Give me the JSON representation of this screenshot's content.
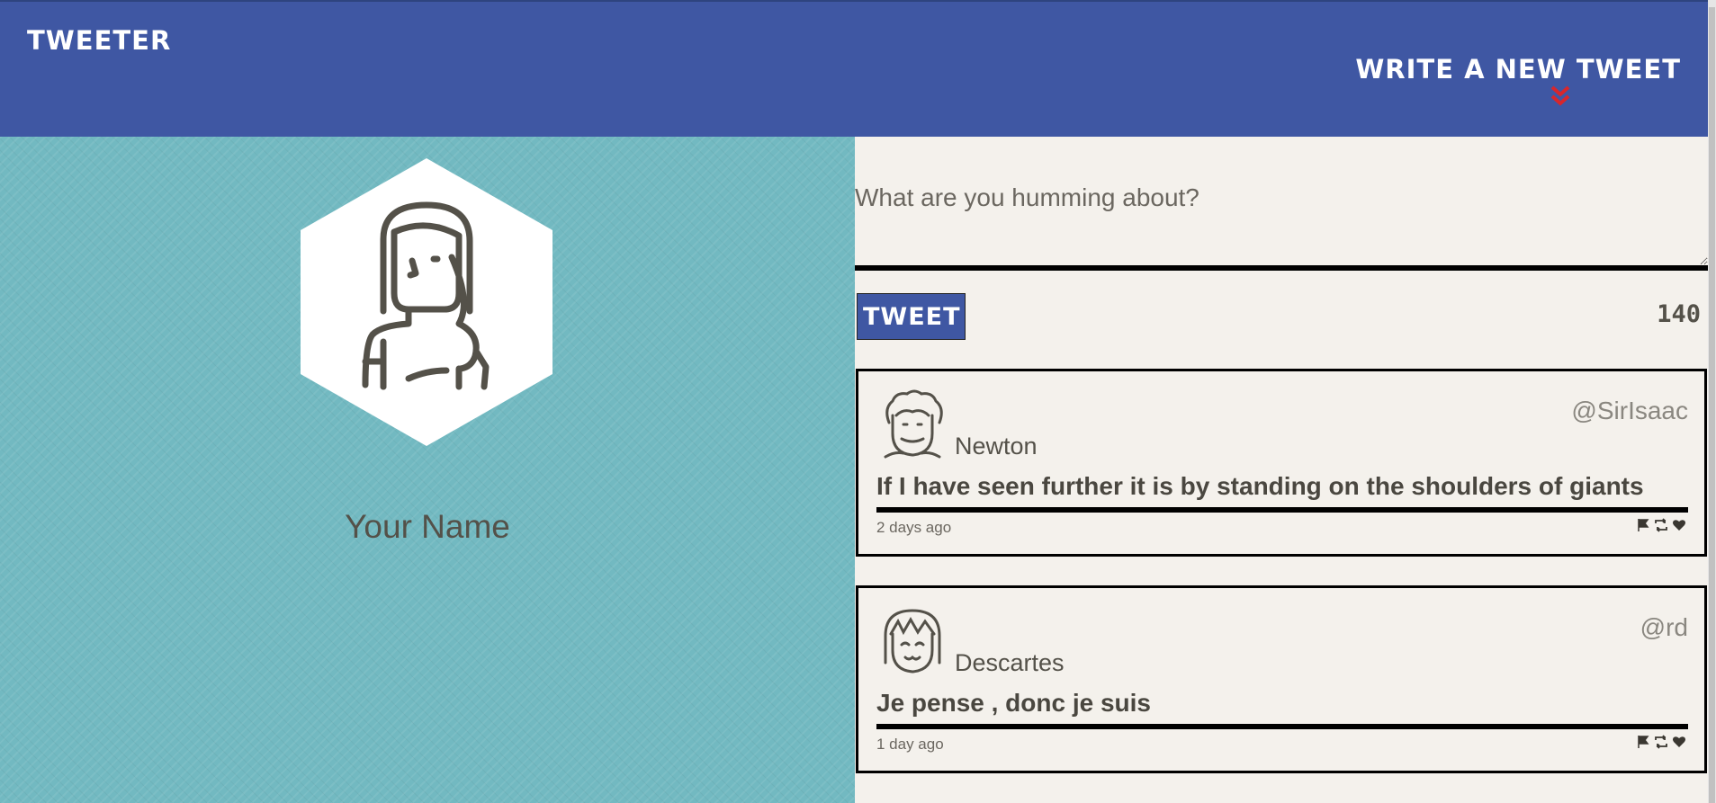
{
  "header": {
    "brand": "Tweeter",
    "compose_label": "Write a new tweet"
  },
  "profile": {
    "name": "Your Name",
    "avatar_icon": "user-avatar-icon"
  },
  "composer": {
    "placeholder": "What are you humming about?",
    "value": "",
    "submit_label": "Tweet",
    "char_counter": "140"
  },
  "tweets": [
    {
      "display_name": "Newton",
      "handle": "@SirIsaac",
      "content": "If I have seen further it is by standing on the shoulders of giants",
      "time": "2 days ago",
      "avatar_icon": "curly-hair-avatar-icon"
    },
    {
      "display_name": "Descartes",
      "handle": "@rd",
      "content": "Je pense , donc je suis",
      "time": "1 day ago",
      "avatar_icon": "bangs-avatar-icon"
    }
  ],
  "colors": {
    "header": "#3f57a3",
    "profile_bg": "#72b9c1",
    "page_bg": "#f4f1ec",
    "accent_chevron": "#d8262c"
  }
}
